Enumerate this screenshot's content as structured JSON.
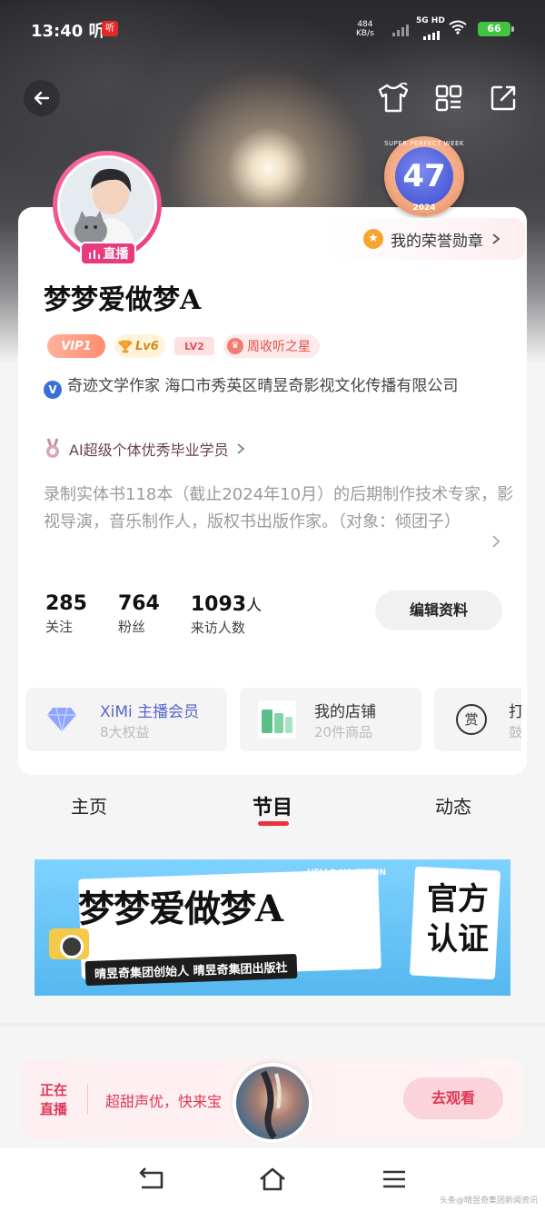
{
  "status_bar": {
    "time": "13:40",
    "app_glyph": "听",
    "app_badge": "听",
    "speed_value": "484",
    "speed_unit": "KB/s",
    "network": "5G HD",
    "battery": "66"
  },
  "profile": {
    "honor_badge_number": "47",
    "honor_badge_ring_text": "SUPER PERFECT WEEK",
    "honor_badge_year": "2024",
    "honor_link_label": "我的荣誉勋章",
    "live_label": "直播",
    "username": "梦梦爱做梦A",
    "tags": {
      "vip": "VIP1",
      "lv6": "Lv6",
      "lv2": "LV2",
      "star": "周收听之星"
    },
    "cert_text": "奇迹文学作家 海口市秀英区晴昱奇影视文化传播有限公司",
    "award_text": "AI超级个体优秀毕业学员",
    "bio": "录制实体书118本（截止2024年10月）的后期制作技术专家，影视导演，音乐制作人，版权书出版作家。（对象：倾团子）",
    "stats": [
      {
        "value": "285",
        "unit": "",
        "label": "关注"
      },
      {
        "value": "764",
        "unit": "",
        "label": "粉丝"
      },
      {
        "value": "1093",
        "unit": "人",
        "label": "来访人数"
      }
    ],
    "edit_button": "编辑资料"
  },
  "services": [
    {
      "title": "XiMi 主播会员",
      "subtitle": "8大权益",
      "icon": "diamond-icon"
    },
    {
      "title": "我的店铺",
      "subtitle": "20件商品",
      "icon": "shop-product-icon"
    },
    {
      "title": "打",
      "subtitle": "鼓",
      "icon": "reward-icon",
      "icon_text": "赏"
    }
  ],
  "tabs": [
    {
      "label": "主页"
    },
    {
      "label": "节目"
    },
    {
      "label": "动态"
    }
  ],
  "banner": {
    "name": "梦梦爱做梦A",
    "subtitle": "晴昱奇集团创始人  晴昱奇集团出版社",
    "official": "官方认证",
    "hello": "HELLO HA ER BIN"
  },
  "live_bar": {
    "now": "正在直播",
    "desc": "超甜声优，快来宝",
    "button": "去观看"
  },
  "watermark": "头条@晴昱奇集团新闻资讯",
  "colors": {
    "accent_red": "#e8323c",
    "live_pink": "#e03655",
    "avatar_ring": "#e83a7d"
  }
}
